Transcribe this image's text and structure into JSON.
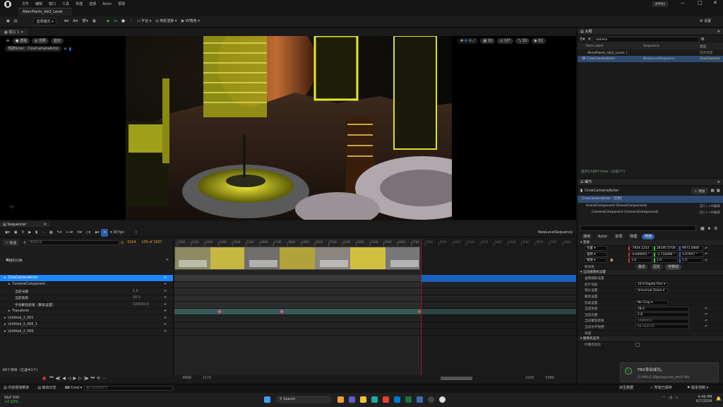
{
  "app": {
    "user_badge": "护PM3"
  },
  "menu": [
    "文件",
    "编辑",
    "窗口",
    "工具",
    "构建",
    "选择",
    "Actor",
    "帮助"
  ],
  "doc_tab": "AlienPlants_Vol2_Level",
  "toolbar": {
    "mode": "选项模式",
    "play_platform": "平台",
    "movie_render": "电影渲染",
    "vp_role": "VP角色",
    "settings": "设置"
  },
  "viewport": {
    "tab_label": "视口 1",
    "perspective": "透视",
    "lit": "光照",
    "show": "显示",
    "pilot": "驾驶Actor：CineCameraActor",
    "grid_value": "10",
    "angle_value": "10°",
    "scale_value": "10",
    "speed_value": "32"
  },
  "outliner": {
    "tab": "大纲",
    "search": "camera",
    "col_label": "Item Label",
    "col_sequence": "Sequence",
    "col_type": "类型",
    "rows": [
      {
        "label": "AlienPlants_Vol2_Level（",
        "sequence": "",
        "type": "世界场景"
      },
      {
        "label": "CineCameraActor",
        "sequence": "NewLevelSequence",
        "type": "CineCamera"
      }
    ],
    "footer": "显示1/189个Actor（已选1个）"
  },
  "details": {
    "tab": "细节",
    "actor_name": "CineCameraActor",
    "add_button": "添加",
    "tree": [
      {
        "label": "CineCameraActor（实例）",
        "right": ""
      },
      {
        "label": "SceneComponent (SceneComponent)",
        "right": "在C++中编辑"
      },
      {
        "label": "CameraComponent (CameraComponent)",
        "right": "在C++中编辑"
      }
    ],
    "search_placeholder": "搜索",
    "filters": [
      "通用",
      "Actor",
      "杂项",
      "物理",
      "所有"
    ],
    "transform_section": "变换",
    "location_label": "位置",
    "location": [
      "-7834.1233",
      "28195.5700",
      "9973.5848"
    ],
    "rotation_label": "旋转",
    "rotation": [
      "-0.000001 °",
      "-1.732084 °",
      "3.07957 °"
    ],
    "scale_label": "缩放",
    "scale": [
      "1.0",
      "1.0",
      "1.0"
    ],
    "mobility_label": "移动性",
    "mobility": [
      "静态",
      "固定",
      "可移动"
    ],
    "camera_settings_section": "当前摄像机设置",
    "lookat_section": "查看跟踪设置",
    "filmback_label": "胶片背板",
    "filmback_value": "16:9 Digital Film",
    "lens_label": "镜头设置",
    "lens_value": "Universal Zoom",
    "focus_section": "聚焦设置",
    "crop_label": "剪裁设置",
    "crop_value": "No Crop",
    "focal_label": "当前焦距",
    "focal_value": "28.0",
    "aperture_label": "当前光圈",
    "aperture_value": "2.8",
    "focus_dist_label": "当前聚焦距离",
    "focus_dist_value": "100000.0",
    "hfov_label": "当前水平视野",
    "hfov_value": "66.934135",
    "misc_section": "高级",
    "render_section": "摄像机选项",
    "constrain_label": "约束高宽比"
  },
  "sequencer": {
    "tab": "Sequencer",
    "fps": "30 fps",
    "sequence_name": "NewLevelSequence",
    "add_track": "轨道",
    "search_placeholder": "搜索轨道",
    "frame": "0104",
    "frame_range": "105 of 1837",
    "camera_cuts": "相机切换",
    "tracks": [
      {
        "label": "CineCameraActor",
        "value": "",
        "selected": true,
        "indent": 0
      },
      {
        "label": "CameraComponent",
        "value": "",
        "selected": false,
        "indent": 1
      },
      {
        "label": "当前光圈",
        "value": "2.8",
        "selected": false,
        "indent": 2
      },
      {
        "label": "当前焦距",
        "value": "28.0",
        "selected": false,
        "indent": 2
      },
      {
        "label": "手动聚焦距离（聚焦设置）",
        "value": "100000.0",
        "selected": false,
        "indent": 2
      },
      {
        "label": "Transform",
        "value": "",
        "selected": false,
        "indent": 1
      },
      {
        "label": "Untitled_2_001",
        "value": "",
        "selected": false,
        "indent": 0
      },
      {
        "label": "Untitled_2_006_1",
        "value": "",
        "selected": false,
        "indent": 0
      },
      {
        "label": "Untitled_2_006",
        "value": "",
        "selected": false,
        "indent": 0
      }
    ],
    "ruler": [
      "1000",
      "1100",
      "1200",
      "1300",
      "1400",
      "1500",
      "1600",
      "1700",
      "1800",
      "1900",
      "2000",
      "2100",
      "2200",
      "2300",
      "2400",
      "2500",
      "2600",
      "2700",
      "2800",
      "2900",
      "3000",
      "3100",
      "3200",
      "3300",
      "3400",
      "3500",
      "3600",
      "3700",
      "3800"
    ],
    "items_count": "60个项目（已选中1个）",
    "range_start": "-8689",
    "range_in": "1172",
    "range_out": "2245",
    "range_end": "5389"
  },
  "statusbar": {
    "content_drawer": "内容侧滑菜单",
    "output_log": "输出日志",
    "cmd": "Cmd",
    "cmd_placeholder": "输入控制台命令",
    "derived": "派生数据",
    "saved": "所有已保存",
    "revision": "版本控制"
  },
  "toast": {
    "title": "FBX导出成功。",
    "path": "G:/UKL/5.2Bgroup/cam_test2.fbx"
  },
  "taskbar": {
    "stock_name": "S&P 500",
    "stock_change": "+0.10%",
    "search": "Search",
    "time": "4:46 PM",
    "date": "6/7/2024"
  }
}
